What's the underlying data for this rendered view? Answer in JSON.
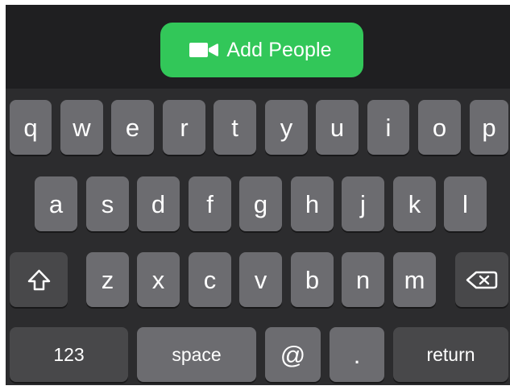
{
  "call": {
    "add_people_label": "Add People",
    "icon": "video-camera-icon",
    "accent_color": "#32c759"
  },
  "keyboard": {
    "row1": [
      "q",
      "w",
      "e",
      "r",
      "t",
      "y",
      "u",
      "i",
      "o",
      "p"
    ],
    "row2": [
      "a",
      "s",
      "d",
      "f",
      "g",
      "h",
      "j",
      "k",
      "l"
    ],
    "row3": [
      "z",
      "x",
      "c",
      "v",
      "b",
      "n",
      "m"
    ],
    "shift_icon": "shift-icon",
    "delete_icon": "backspace-icon",
    "bottom": {
      "numbers": "123",
      "space": "space",
      "at": "@",
      "dot": ".",
      "return": "return"
    },
    "key_color": "#6c6c70",
    "function_key_color": "#48484a"
  }
}
